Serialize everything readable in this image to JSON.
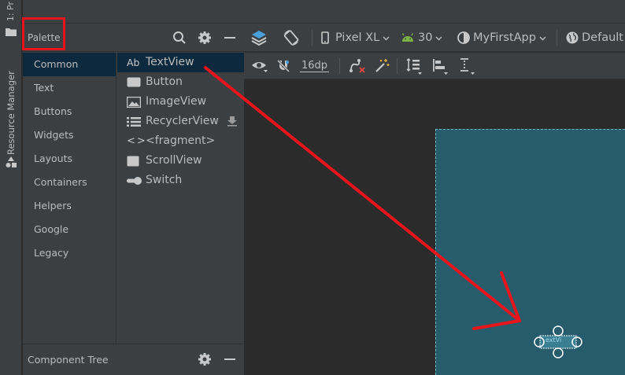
{
  "tool_strip": {
    "top_label": "1: Pr",
    "resource_manager_label": "Resource Manager"
  },
  "palette": {
    "title": "Palette",
    "categories": [
      {
        "label": "Common",
        "selected": true
      },
      {
        "label": "Text",
        "selected": false
      },
      {
        "label": "Buttons",
        "selected": false
      },
      {
        "label": "Widgets",
        "selected": false
      },
      {
        "label": "Layouts",
        "selected": false
      },
      {
        "label": "Containers",
        "selected": false
      },
      {
        "label": "Helpers",
        "selected": false
      },
      {
        "label": "Google",
        "selected": false
      },
      {
        "label": "Legacy",
        "selected": false
      }
    ],
    "widgets": [
      {
        "label": "TextView",
        "icon": "textview-icon",
        "icon_text": "Ab",
        "selected": true
      },
      {
        "label": "Button",
        "icon": "button-icon",
        "selected": false
      },
      {
        "label": "ImageView",
        "icon": "imageview-icon",
        "selected": false
      },
      {
        "label": "RecyclerView",
        "icon": "recyclerview-icon",
        "selected": false,
        "downloadable": true
      },
      {
        "label": "<fragment>",
        "icon": "fragment-icon",
        "icon_text": "<>",
        "selected": false
      },
      {
        "label": "ScrollView",
        "icon": "scrollview-icon",
        "selected": false
      },
      {
        "label": "Switch",
        "icon": "switch-icon",
        "selected": false
      }
    ]
  },
  "component_tree": {
    "title": "Component Tree"
  },
  "toolbar": {
    "device": "Pixel XL",
    "api_level": "30",
    "theme": "MyFirstApp",
    "locale": "Default",
    "margin": "16dp"
  },
  "canvas": {
    "selected_view_label": "extVi"
  },
  "colors": {
    "highlight_red": "#e8141b",
    "selection_blue": "#0d293e",
    "device_screen": "#265c6c",
    "android_green": "#7cb342",
    "layers_blue": "#4a9fdb"
  }
}
